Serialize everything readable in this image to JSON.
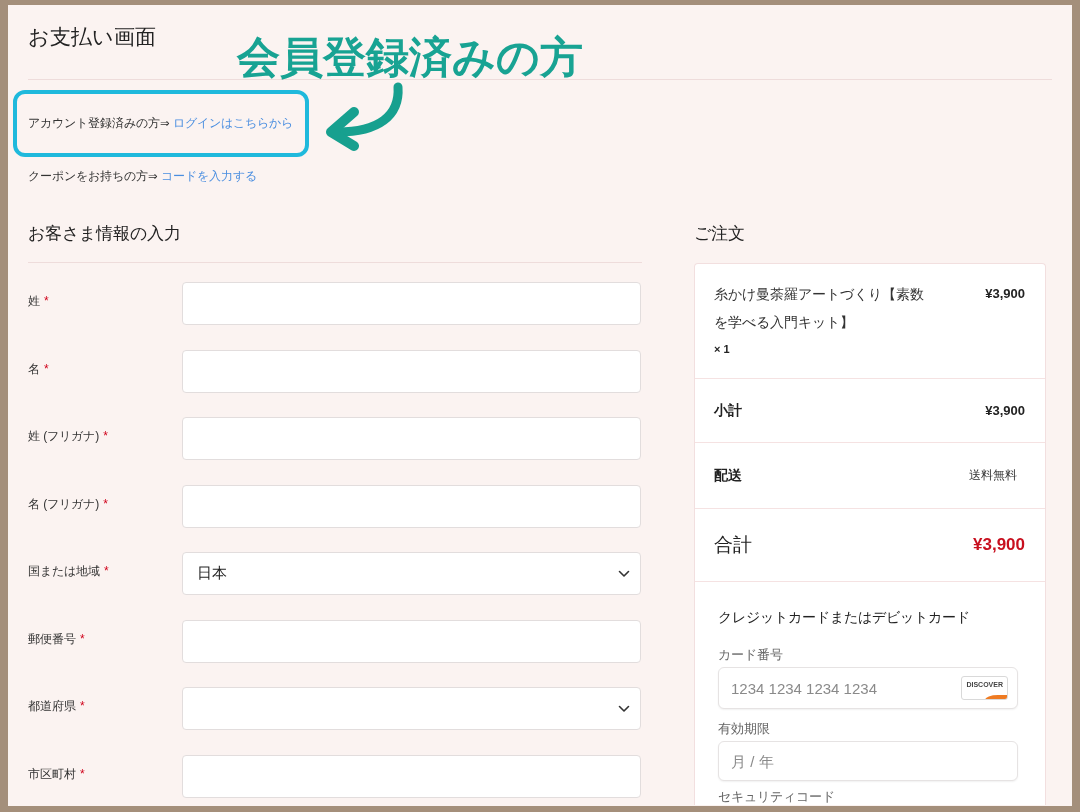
{
  "page": {
    "title": "お支払い画面"
  },
  "annotation": {
    "callout": "会員登録済みの方"
  },
  "notices": [
    {
      "text": "アカウント登録済みの方⇒",
      "link": "ログインはこちらから",
      "highlighted": true
    },
    {
      "text": "クーポンをお持ちの方⇒",
      "link": "コードを入力する",
      "highlighted": false
    }
  ],
  "customer_form": {
    "heading": "お客さま情報の入力",
    "fields": [
      {
        "label": "姓",
        "mark": "*",
        "kind": "text"
      },
      {
        "label": "名",
        "mark": "*",
        "kind": "text"
      },
      {
        "label": "姓 (フリガナ)",
        "mark": "*",
        "kind": "text"
      },
      {
        "label": "名 (フリガナ)",
        "mark": "*",
        "kind": "text"
      },
      {
        "label": "国または地域",
        "mark": "*",
        "kind": "select",
        "value": "日本"
      },
      {
        "label": "郵便番号",
        "mark": "*",
        "kind": "text"
      },
      {
        "label": "都道府県",
        "mark": "*",
        "kind": "select"
      },
      {
        "label": "市区町村",
        "mark": "*",
        "kind": "text"
      }
    ]
  },
  "order": {
    "heading": "ご注文",
    "items": [
      {
        "name": "糸かけ曼荼羅アートづくり【素数を学べる入門キット】",
        "quantity": "× 1",
        "price": "¥3,900"
      }
    ],
    "subtotal": {
      "label": "小計",
      "value": "¥3,900"
    },
    "shipping": {
      "label": "配送",
      "value": "送料無料"
    },
    "total": {
      "label": "合計",
      "value": "¥3,900"
    }
  },
  "payment": {
    "heading": "クレジットカードまたはデビットカード",
    "fields": [
      {
        "label": "カード番号",
        "kind": "card",
        "placeholder": "1234 1234 1234 1234",
        "brand": "DISCOVER"
      },
      {
        "label": "有効期限",
        "kind": "text",
        "placeholder": "月 / 年"
      },
      {
        "label": "セキュリティコード",
        "kind": "label"
      }
    ]
  }
}
